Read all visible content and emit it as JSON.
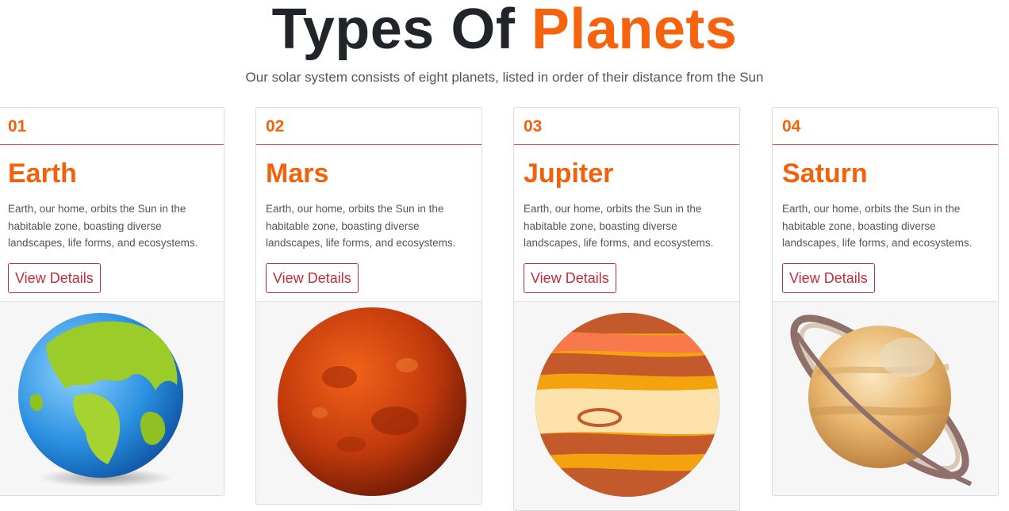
{
  "header": {
    "title_main": "Types Of",
    "title_accent": "Planets",
    "subtitle": "Our solar system consists of eight planets, listed in order of their distance from the Sun"
  },
  "colors": {
    "accent": "#f7630c",
    "button": "#c62b3a",
    "divider": "#d9534f"
  },
  "cards": [
    {
      "number": "01",
      "name": "Earth",
      "description": "Earth, our home, orbits the Sun in the habitable zone, boasting diverse landscapes, life forms, and ecosystems.",
      "button": "View Details",
      "image_icon": "earth-icon"
    },
    {
      "number": "02",
      "name": "Mars",
      "description": "Earth, our home, orbits the Sun in the habitable zone, boasting diverse landscapes, life forms, and ecosystems.",
      "button": "View Details",
      "image_icon": "mars-icon"
    },
    {
      "number": "03",
      "name": "Jupiter",
      "description": "Earth, our home, orbits the Sun in the habitable zone, boasting diverse landscapes, life forms, and ecosystems.",
      "button": "View Details",
      "image_icon": "jupiter-icon"
    },
    {
      "number": "04",
      "name": "Saturn",
      "description": "Earth, our home, orbits the Sun in the habitable zone, boasting diverse landscapes, life forms, and ecosystems.",
      "button": "View Details",
      "image_icon": "saturn-icon"
    }
  ]
}
